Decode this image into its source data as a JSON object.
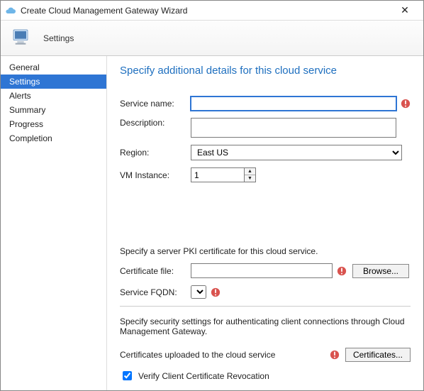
{
  "window": {
    "title": "Create Cloud Management Gateway Wizard"
  },
  "header": {
    "step_name": "Settings"
  },
  "sidebar": {
    "items": [
      {
        "label": "General"
      },
      {
        "label": "Settings"
      },
      {
        "label": "Alerts"
      },
      {
        "label": "Summary"
      },
      {
        "label": "Progress"
      },
      {
        "label": "Completion"
      }
    ],
    "selected_index": 1
  },
  "content": {
    "heading": "Specify additional details for this cloud service",
    "service_name": {
      "label": "Service name:",
      "value": ""
    },
    "description": {
      "label": "Description:",
      "value": ""
    },
    "region": {
      "label": "Region:",
      "value": "East US"
    },
    "vm_instance": {
      "label": "VM Instance:",
      "value": "1"
    },
    "pki_text": "Specify a server PKI certificate for this cloud service.",
    "cert_file": {
      "label": "Certificate file:",
      "value": "",
      "browse": "Browse..."
    },
    "service_fqdn": {
      "label": "Service FQDN:",
      "value": ""
    },
    "security_text": "Specify security settings for authenticating client connections through Cloud Management Gateway.",
    "uploaded_text": "Certificates uploaded to the cloud service",
    "certificates_btn": "Certificates...",
    "verify_checkbox": {
      "label": "Verify Client Certificate Revocation",
      "checked": true
    }
  }
}
